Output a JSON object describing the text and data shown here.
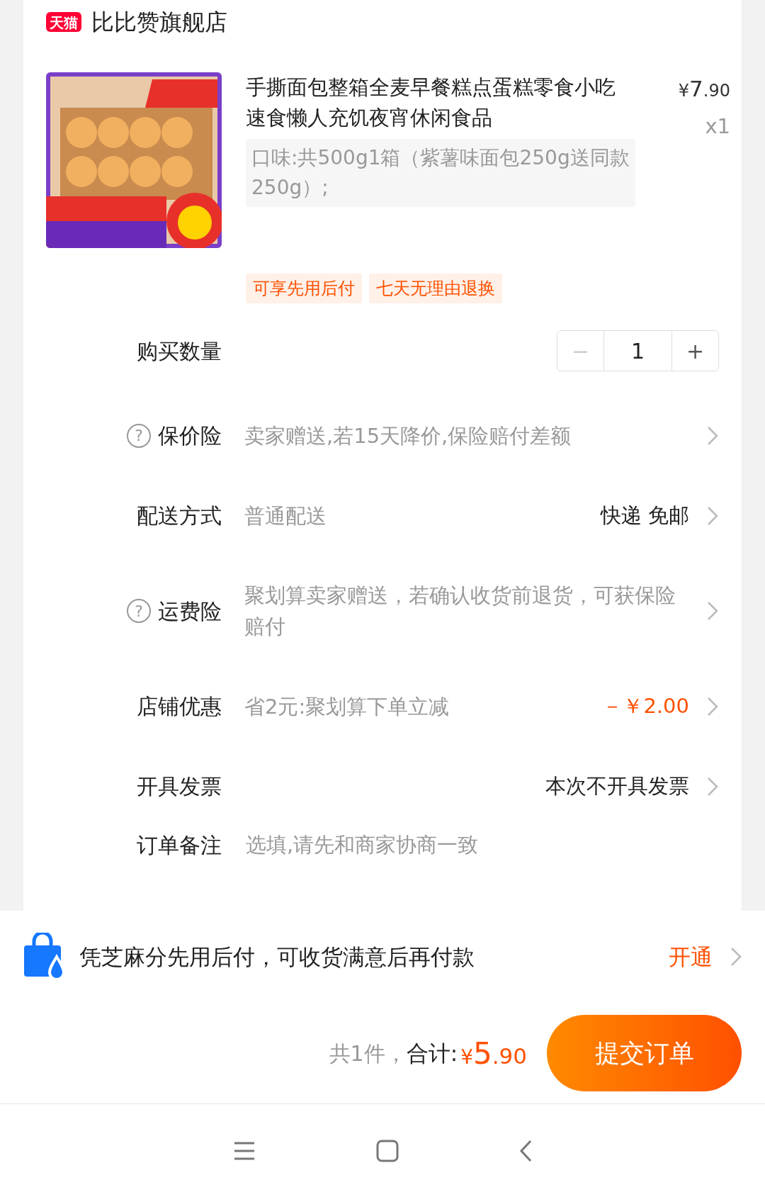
{
  "store": {
    "badge": "天猫",
    "name": "比比赞旗舰店"
  },
  "product": {
    "title": "手撕面包整箱全麦早餐糕点蛋糕零食小吃速食懒人充饥夜宵休闲食品",
    "currency": "¥",
    "price_int": "7",
    "price_dec": ".90",
    "quantity": "x1",
    "spec": "口味:共500g1箱（紫薯味面包250g送同款250g）;",
    "tags": [
      "可享先用后付",
      "七天无理由退换"
    ]
  },
  "rows": [
    {
      "kind": "stepper",
      "label": "购买数量",
      "minus": "−",
      "value": "1",
      "plus": "+",
      "minus_disabled": true
    },
    {
      "kind": "info",
      "help": "?",
      "label": "保价险",
      "value": "卖家赠送,若15天降价,保险赔付差额",
      "chevron": true
    },
    {
      "kind": "info",
      "label": "配送方式",
      "value": "普通配送",
      "right": "快递 免邮",
      "chevron": true
    },
    {
      "kind": "info",
      "help": "?",
      "label": "运费险",
      "value": "聚划算卖家赠送，若确认收货前退货，可获保险赔付",
      "chevron": true
    },
    {
      "kind": "info",
      "label": "店铺优惠",
      "value": "省2元:聚划算下单立减",
      "right": "－￥2.00",
      "right_highlight": true,
      "chevron": true
    },
    {
      "kind": "info",
      "label": "开具发票",
      "right": "本次不开具发票",
      "chevron": true
    },
    {
      "kind": "input",
      "label": "订单备注",
      "placeholder": "选填,请先和商家协商一致"
    }
  ],
  "credit_bar": {
    "text": "凭芝麻分先用后付，可收货满意后再付款",
    "action": "开通",
    "chevron": true
  },
  "footer": {
    "count": "共1件，",
    "total_label": "合计:",
    "currency": "¥",
    "amount_int": "5",
    "amount_dec": ".90",
    "submit": "提交订单"
  }
}
